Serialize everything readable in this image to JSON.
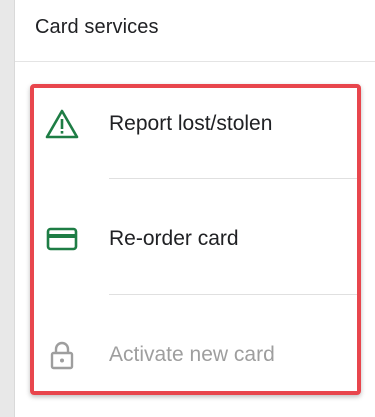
{
  "section": {
    "title": "Card services"
  },
  "items": [
    {
      "label": "Report lost/stolen",
      "icon": "warning-triangle-icon",
      "enabled": true
    },
    {
      "label": "Re-order card",
      "icon": "credit-card-icon",
      "enabled": true
    },
    {
      "label": "Activate new card",
      "icon": "lock-icon",
      "enabled": false
    }
  ],
  "colors": {
    "accent_green": "#1e7d45",
    "disabled_gray": "#9e9e9e",
    "highlight_red": "#e8464d"
  }
}
